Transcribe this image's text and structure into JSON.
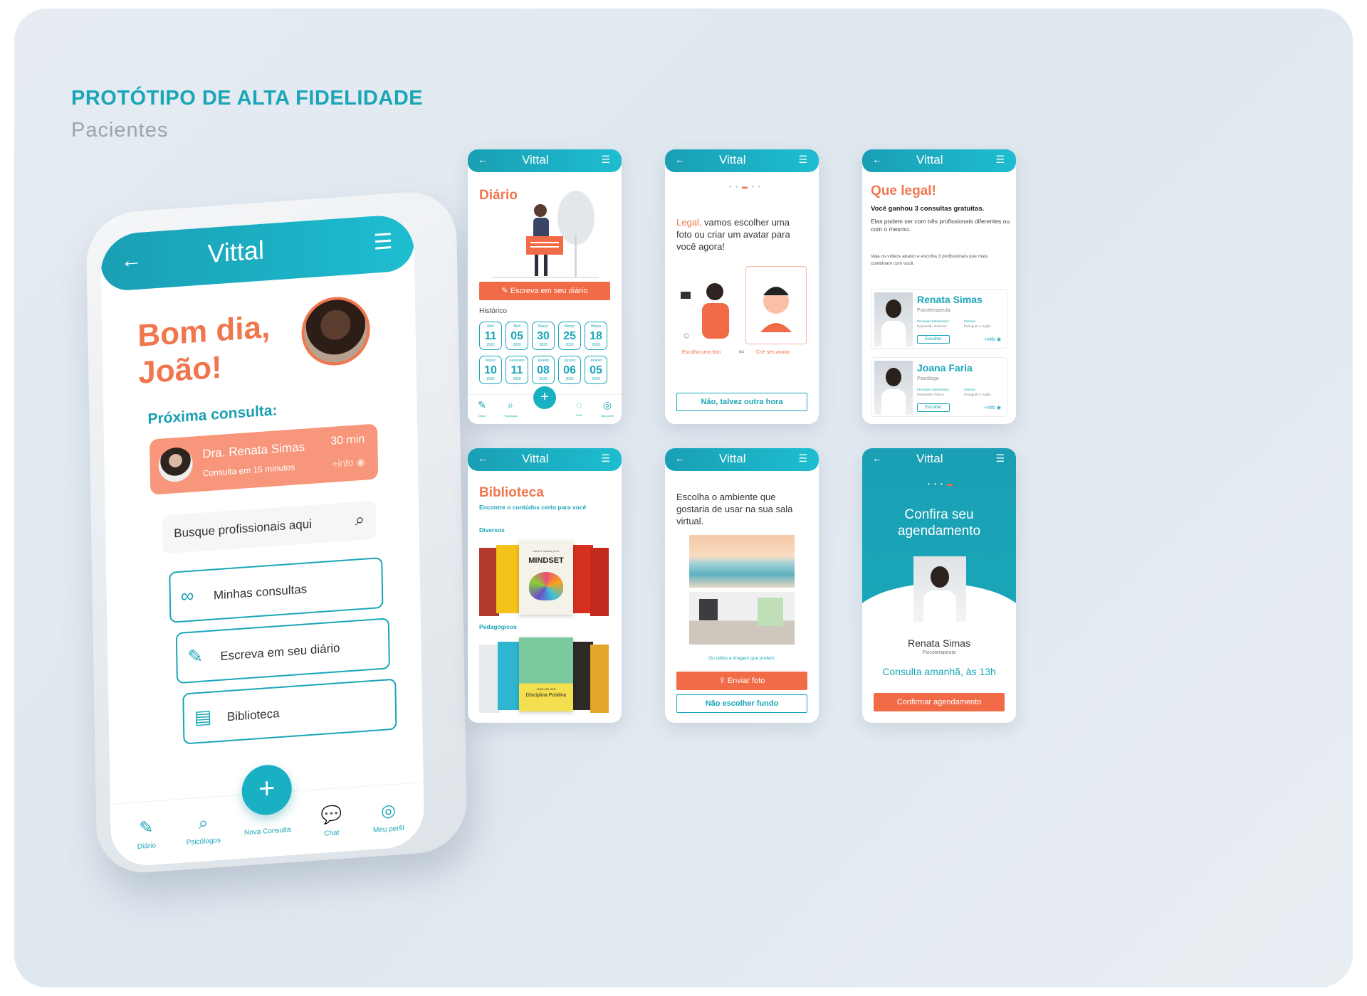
{
  "header": {
    "title": "PROTÓTIPO DE ALTA FIDELIDADE",
    "subtitle": "Pacientes"
  },
  "app": {
    "logo": "Vittal"
  },
  "colors": {
    "teal": "#1aa6b8",
    "coral": "#f0764e",
    "button_orange": "#f26b47"
  },
  "home": {
    "greeting_line1": "Bom dia,",
    "greeting_line2": "João!",
    "next_label": "Próxima consulta:",
    "next_card": {
      "name": "Dra. Renata Simas",
      "subtitle": "Consulta em 15 minutos",
      "duration": "30 min",
      "more": "+info"
    },
    "search_placeholder": "Busque profissionais aqui",
    "menu": [
      {
        "label": "Minhas consultas",
        "icon": "glasses-icon"
      },
      {
        "label": "Escreva em seu diário",
        "icon": "edit-icon"
      },
      {
        "label": "Biblioteca",
        "icon": "document-icon"
      }
    ],
    "nav": {
      "diary": "Diário",
      "psych": "Psicólogos",
      "new": "Nova Consulta",
      "chat": "Chat",
      "profile": "Meu perfil"
    }
  },
  "diary": {
    "title": "Diário",
    "button": "Escreva em seu diário",
    "history_label": "Histórico",
    "dates": [
      {
        "month": "Abril",
        "day": "11",
        "year": "2020"
      },
      {
        "month": "Abril",
        "day": "05",
        "year": "2020"
      },
      {
        "month": "Março",
        "day": "30",
        "year": "2020"
      },
      {
        "month": "Março",
        "day": "25",
        "year": "2020"
      },
      {
        "month": "Março",
        "day": "18",
        "year": "2020"
      },
      {
        "month": "Março",
        "day": "10",
        "year": "2020"
      },
      {
        "month": "Fevereiro",
        "day": "11",
        "year": "2020"
      },
      {
        "month": "Janeiro",
        "day": "08",
        "year": "2020"
      },
      {
        "month": "Janeiro",
        "day": "06",
        "year": "2020"
      },
      {
        "month": "Janeiro",
        "day": "05",
        "year": "2020"
      }
    ]
  },
  "avatar": {
    "text_highlight": "Legal,",
    "text_rest": "vamos escolher uma foto ou criar um avatar para você agora!",
    "option_photo": "Escolha uma foto",
    "or": "ou",
    "option_avatar": "Crie seu avatar",
    "later_button": "Não, talvez outra hora"
  },
  "gift": {
    "title": "Que legal!",
    "headline": "Você ganhou 3 consultas gratuitas.",
    "text": "Elas podem ser com três profissionais diferentes ou com o mesmo.",
    "hint": "Veja os vídeos abaixo e escolha 3 profissionais que mais combinam com você.",
    "pros": [
      {
        "name": "Renata Simas",
        "role": "Psicoterapeuta",
        "h1": "Principais tratamentos:",
        "v1": "Depressão, Estresse",
        "h2": "Idiomas:",
        "v2": "Português e Inglês",
        "choose": "Escolher",
        "more": "+info"
      },
      {
        "name": "Joana Faria",
        "role": "Psicóloga",
        "h1": "Principais tratamentos:",
        "v1": "Depressão, Pânico",
        "h2": "Idiomas:",
        "v2": "Português e Inglês",
        "choose": "Escolher",
        "more": "+info"
      }
    ]
  },
  "library": {
    "title": "Biblioteca",
    "subtitle": "Encontre o contúdos certo para você",
    "section1": "Diversos",
    "section2": "Pedagógicos",
    "book1_title": "MINDSET",
    "book1_author": "Carol S. Dweck ph.D.",
    "book2_title": "Disciplina Positiva",
    "book2_author": "JANE NELSEN"
  },
  "environment": {
    "text": "Escolha o ambiente que gostaria de usar na sua sala virtual.",
    "hint": "Ou utilize a imagem que preferir.",
    "send_button": "Enviar foto",
    "skip_button": "Não escolher fundo"
  },
  "confirm": {
    "title": "Confira seu agendamento",
    "name": "Renata Simas",
    "role": "Psicoterapeuta",
    "when": "Consulta amanhã, às 13h",
    "button": "Confirmar agendamento"
  }
}
